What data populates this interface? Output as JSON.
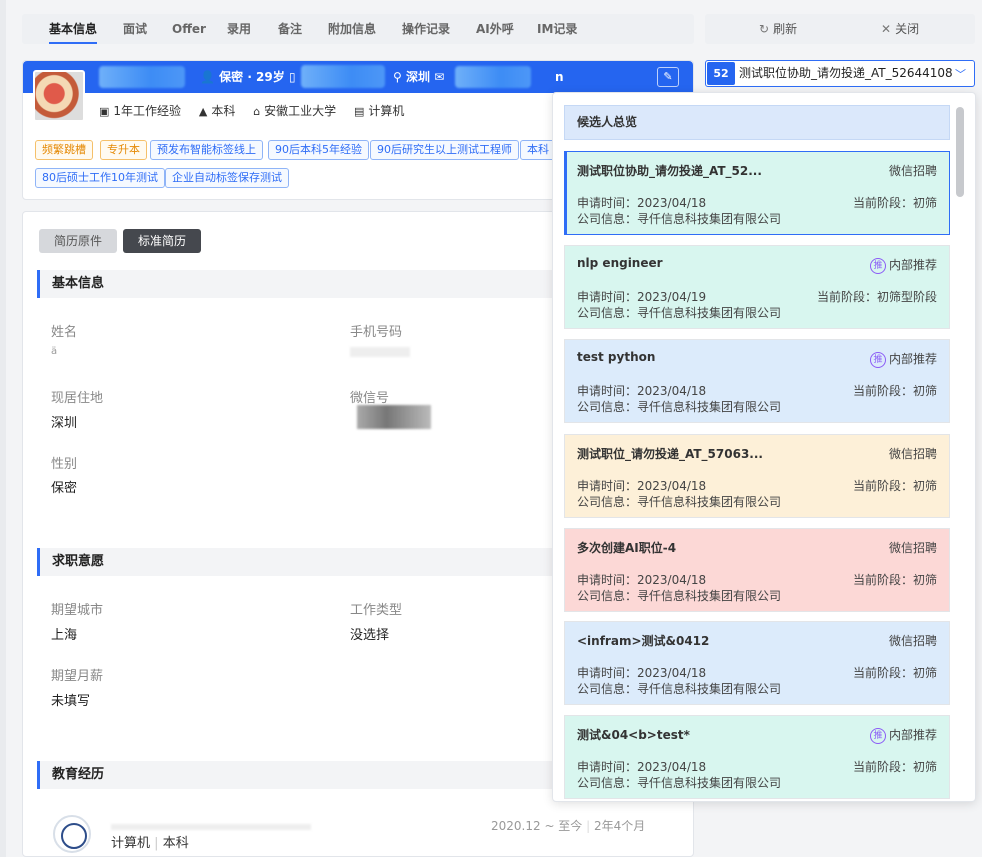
{
  "tabs": [
    {
      "label": "基本信息",
      "active": true
    },
    {
      "label": "面试"
    },
    {
      "label": "Offer"
    },
    {
      "label": "录用"
    },
    {
      "label": "备注"
    },
    {
      "label": "附加信息"
    },
    {
      "label": "操作记录"
    },
    {
      "label": "AI外呼"
    },
    {
      "label": "IM记录"
    }
  ],
  "actions": {
    "refresh": "刷新",
    "close": "关闭"
  },
  "profile": {
    "gender_age": "保密 · 29岁",
    "city": "深圳",
    "email_suffix": "n",
    "experience": "1年工作经验",
    "degree": "本科",
    "school": "安徽工业大学",
    "major": "计算机",
    "tags": [
      "频繁跳槽",
      "专升本",
      "预发布智能标签线上",
      "90后本科5年经验",
      "90后研究生以上测试工程师",
      "本科",
      "80后硕士工作10年测试",
      "企业自动标签保存测试"
    ]
  },
  "resume": {
    "toggle_original": "简历原件",
    "toggle_standard": "标准简历",
    "basic_section": "基本信息",
    "name_label": "姓名",
    "name_value": "ä",
    "phone_label": "手机号码",
    "address_label": "现居住地",
    "address_value": "深圳",
    "wechat_label": "微信号",
    "gender_label": "性别",
    "gender_value": "保密",
    "intent_section": "求职意愿",
    "city_label": "期望城市",
    "city_value": "上海",
    "worktype_label": "工作类型",
    "worktype_value": "没选择",
    "salary_label": "期望月薪",
    "salary_value": "未填写",
    "edu_section": "教育经历",
    "edu_period": "2020.12 ~ 至今",
    "edu_duration": "2年4个月",
    "edu_major": "计算机",
    "edu_degree": "本科"
  },
  "job_select": {
    "count": "52",
    "selected": "测试职位协助_请勿投递_AT_52644108"
  },
  "dropdown": {
    "overview": "候选人总览",
    "cards": [
      {
        "title": "测试职位协助_请勿投递_AT_52...",
        "source": "微信招聘",
        "referral": false,
        "date": "申请时间：2023/04/18",
        "stage": "当前阶段：初筛",
        "company": "公司信息：寻仟信息科技集团有限公司",
        "color": "teal",
        "active": true
      },
      {
        "title": "nlp engineer",
        "source": "内部推荐",
        "referral": true,
        "date": "申请时间：2023/04/19",
        "stage": "当前阶段：初筛型阶段",
        "company": "公司信息：寻仟信息科技集团有限公司",
        "color": "teal"
      },
      {
        "title": "test python",
        "source": "内部推荐",
        "referral": true,
        "date": "申请时间：2023/04/18",
        "stage": "当前阶段：初筛",
        "company": "公司信息：寻仟信息科技集团有限公司",
        "color": "blue"
      },
      {
        "title": "测试职位_请勿投递_AT_57063...",
        "source": "微信招聘",
        "referral": false,
        "date": "申请时间：2023/04/18",
        "stage": "当前阶段：初筛",
        "company": "公司信息：寻仟信息科技集团有限公司",
        "color": "yellow"
      },
      {
        "title": "多次创建AI职位-4",
        "source": "微信招聘",
        "referral": false,
        "date": "申请时间：2023/04/18",
        "stage": "当前阶段：初筛",
        "company": "公司信息：寻仟信息科技集团有限公司",
        "color": "red"
      },
      {
        "title": "<infram>测试&0412",
        "source": "微信招聘",
        "referral": false,
        "date": "申请时间：2023/04/18",
        "stage": "当前阶段：初筛",
        "company": "公司信息：寻仟信息科技集团有限公司",
        "color": "blue"
      },
      {
        "title": "测试&04<b>test*",
        "source": "内部推荐",
        "referral": true,
        "date": "申请时间：2023/04/18",
        "stage": "当前阶段：初筛",
        "company": "公司信息：寻仟信息科技集团有限公司",
        "color": "teal"
      }
    ],
    "referral_badge": "推"
  }
}
